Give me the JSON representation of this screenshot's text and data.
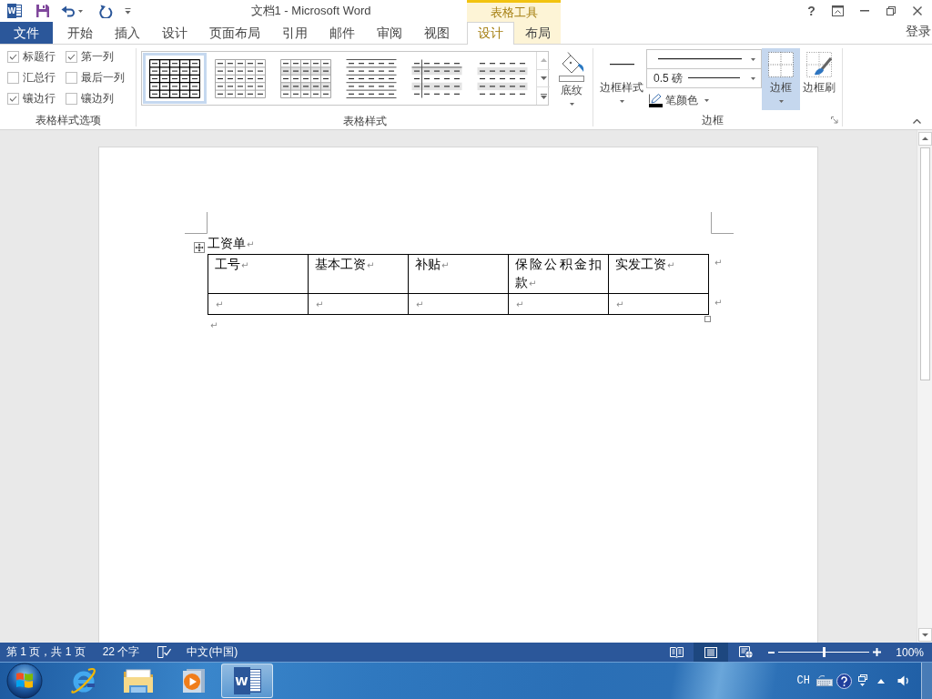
{
  "title_bar": {
    "logo": "W",
    "title": "文档1 - Microsoft Word",
    "help": "?"
  },
  "ribbon_tabs": {
    "file": "文件",
    "tabs": [
      {
        "label": "开始",
        "selected": false
      },
      {
        "label": "插入",
        "selected": false
      },
      {
        "label": "设计",
        "selected": false
      },
      {
        "label": "页面布局",
        "selected": false
      },
      {
        "label": "引用",
        "selected": false
      },
      {
        "label": "邮件",
        "selected": false
      },
      {
        "label": "审阅",
        "selected": false
      },
      {
        "label": "视图",
        "selected": false
      }
    ],
    "contextual": {
      "title": "表格工具",
      "tabs": [
        {
          "label": "设计",
          "selected": true
        },
        {
          "label": "布局",
          "selected": false
        }
      ]
    },
    "sign_in": "登录"
  },
  "ribbon": {
    "style_options": {
      "title": "表格样式选项",
      "options": [
        {
          "label": "标题行",
          "checked": true
        },
        {
          "label": "第一列",
          "checked": true
        },
        {
          "label": "汇总行",
          "checked": false
        },
        {
          "label": "最后一列",
          "checked": false
        },
        {
          "label": "镶边行",
          "checked": true
        },
        {
          "label": "镶边列",
          "checked": false
        }
      ]
    },
    "table_styles": {
      "title": "表格样式",
      "styles": [
        {
          "kind": "grid",
          "selected": true
        },
        {
          "kind": "grid_light",
          "selected": false
        },
        {
          "kind": "grid_shaded",
          "selected": false
        },
        {
          "kind": "lines",
          "selected": false
        },
        {
          "kind": "first_column",
          "selected": false
        },
        {
          "kind": "plain",
          "selected": false
        }
      ],
      "shading": "底纹"
    },
    "borders": {
      "title": "边框",
      "border_styles": "边框样式",
      "line_weight": "0.5 磅",
      "pen_color": {
        "label": "笔颜色",
        "color": "#000000"
      },
      "borders_button": {
        "label": "边框",
        "selected": true
      },
      "border_painter": "边框刷"
    }
  },
  "document": {
    "heading": {
      "text": "工资单",
      "mark": "↵"
    },
    "table": {
      "rows": [
        {
          "cells": [
            {
              "text": "工号",
              "mark": "↵"
            },
            {
              "text": "基本工资",
              "mark": "↵"
            },
            {
              "text": "补贴",
              "mark": "↵"
            },
            {
              "text": "保险公积金扣款",
              "mark": "↵"
            },
            {
              "text": "实发工资",
              "mark": "↵"
            }
          ],
          "end_mark": "↵"
        },
        {
          "cells": [
            {
              "mark": "↵"
            },
            {
              "mark": "↵"
            },
            {
              "mark": "↵"
            },
            {
              "mark": "↵"
            },
            {
              "mark": "↵"
            }
          ],
          "end_mark": "↵"
        }
      ]
    },
    "after_table": {
      "mark": "↵"
    }
  },
  "status_bar": {
    "page": "第 1 页，共 1 页",
    "words": "22 个字",
    "language": "中文(中国)",
    "views": [
      {
        "kind": "read",
        "selected": false
      },
      {
        "kind": "print",
        "selected": true
      },
      {
        "kind": "web",
        "selected": false
      }
    ],
    "zoom": {
      "level": 0.5,
      "reading": "100%"
    }
  },
  "taskbar": {
    "apps": [
      {
        "kind": "browser",
        "selected": false
      },
      {
        "kind": "files",
        "selected": false
      },
      {
        "kind": "media",
        "selected": false
      },
      {
        "kind": "word",
        "selected": true,
        "logo": "W"
      }
    ],
    "tray": {
      "language": "CH"
    }
  }
}
